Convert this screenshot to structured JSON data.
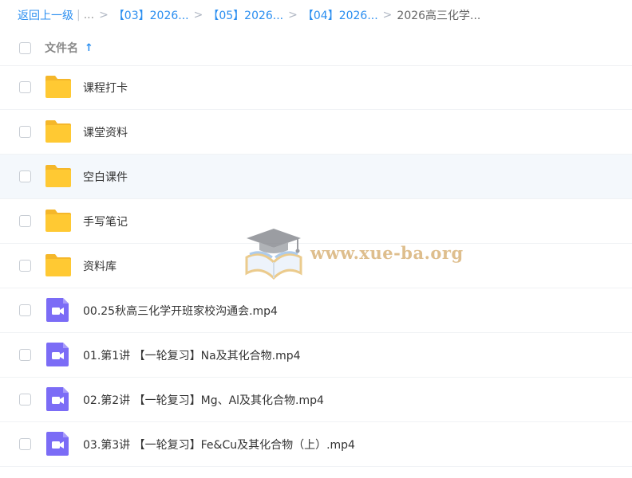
{
  "breadcrumb": {
    "back_label": "返回上一级",
    "pipe": "|",
    "more": "...",
    "sep": ">",
    "items": [
      "【03】2026...",
      "【05】2026...",
      "【04】2026..."
    ],
    "current": "2026高三化学..."
  },
  "header": {
    "column_label": "文件名",
    "sort_glyph": "↑"
  },
  "files": [
    {
      "type": "folder",
      "name": "课程打卡"
    },
    {
      "type": "folder",
      "name": "课堂资料"
    },
    {
      "type": "folder",
      "name": "空白课件"
    },
    {
      "type": "folder",
      "name": "手写笔记"
    },
    {
      "type": "folder",
      "name": "资料库"
    },
    {
      "type": "video",
      "name": "00.25秋高三化学开班家校沟通会.mp4"
    },
    {
      "type": "video",
      "name": "01.第1讲 【一轮复习】Na及其化合物.mp4"
    },
    {
      "type": "video",
      "name": "02.第2讲 【一轮复习】Mg、Al及其化合物.mp4"
    },
    {
      "type": "video",
      "name": "03.第3讲 【一轮复习】Fe&Cu及其化合物（上）.mp4"
    }
  ],
  "watermark": {
    "text": "www.xue-ba.org",
    "icon": "graduation-cap-book-icon"
  },
  "colors": {
    "link": "#2a8ef0",
    "folder": "#ffc933",
    "video": "#7b6cf6",
    "hover_row": "#f4f8fc"
  }
}
